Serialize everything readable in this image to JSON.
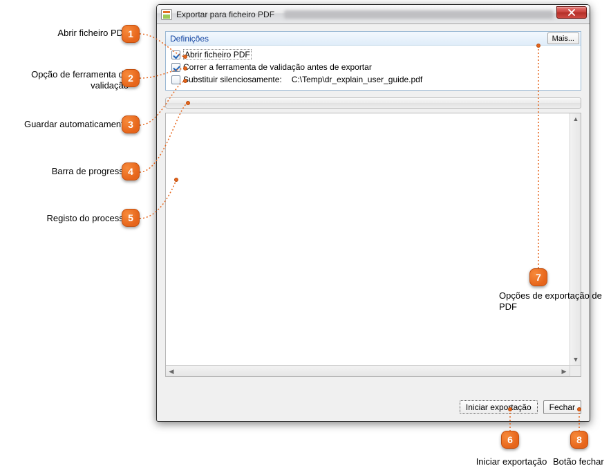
{
  "dialog": {
    "title": "Exportar para ficheiro PDF"
  },
  "definitions": {
    "header": "Definições",
    "more_label": "Mais...",
    "open_pdf_label": "Abrir ficheiro PDF",
    "run_validation_label": "Correr a ferramenta de validação antes de exportar",
    "silent_overwrite_label": "Substituir silenciosamente:",
    "path": "C:\\Temp\\dr_explain_user_guide.pdf"
  },
  "footer": {
    "start_export": "Iniciar exportação",
    "close": "Fechar"
  },
  "callouts": {
    "c1": "Abrir ficheiro PDF",
    "c2": "Opção de ferramenta de validação",
    "c3": "Guardar automaticamente",
    "c4": "Barra de progresso",
    "c5": "Registo do processo",
    "c6": "Iniciar exportação",
    "c7": "Opções de exportação de PDF",
    "c8": "Botão fechar",
    "n1": "1",
    "n2": "2",
    "n3": "3",
    "n4": "4",
    "n5": "5",
    "n6": "6",
    "n7": "7",
    "n8": "8"
  }
}
